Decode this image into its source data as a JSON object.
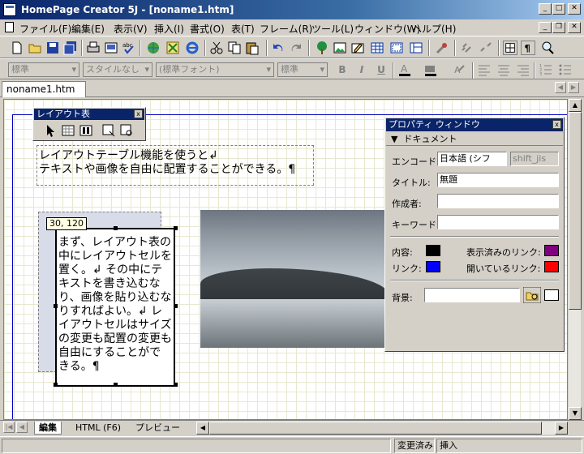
{
  "window": {
    "title": "HomePage Creator 5J - [noname1.htm]"
  },
  "menu": [
    "ファイル(F)",
    "編集(E)",
    "表示(V)",
    "挿入(I)",
    "書式(O)",
    "表(T)",
    "フレーム(R)",
    "ツール(L)",
    "ウィンドウ(W)",
    "ヘルプ(H)"
  ],
  "format_toolbar": {
    "paragraph_style": "標準",
    "class_style": "スタイルなし",
    "font": "(標準フォント)",
    "font_size": "標準",
    "bold": "B",
    "italic": "I",
    "underline": "U"
  },
  "document_tab": "noname1.htm",
  "layout_palette": {
    "title": "レイアウト表",
    "close": "x"
  },
  "editor": {
    "text_line1": "レイアウトテーブル機能を使うと↲",
    "text_line2": "テキストや画像を自由に配置することができる。¶",
    "coord_tooltip": "30, 120",
    "cell_text": " まず、レイアウト表の中にレイアウトセルを置く。↲ その中にテキストを書き込むなり、画像を貼り込むなりすればよい。↲ レイアウトセルはサイズの変更も配置の変更も自由にすることができる。¶"
  },
  "properties": {
    "title": "プロパティ ウィンドウ",
    "close": "x",
    "section": "ドキュメント",
    "encoding_label": "エンコード:",
    "encoding_value": "日本語 (シフ",
    "encoding_charset": "shift_jis",
    "title_label": "タイトル:",
    "title_value": "無題",
    "author_label": "作成者:",
    "author_value": "",
    "keyword_label": "キーワード:",
    "keyword_value": "",
    "text_color_label": "内容:",
    "visited_link_label": "表示済みのリンク:",
    "link_label": "リンク:",
    "active_link_label": "開いているリンク:",
    "background_label": "背景:",
    "background_value": "",
    "colors": {
      "text": "#000000",
      "visited": "#800080",
      "link": "#0000ff",
      "active": "#ff0000",
      "background": "#ffffff"
    }
  },
  "view_tabs": [
    "編集",
    "HTML (F6)",
    "プレビュー"
  ],
  "status": {
    "modified": "変更済み",
    "insert": "挿入"
  }
}
